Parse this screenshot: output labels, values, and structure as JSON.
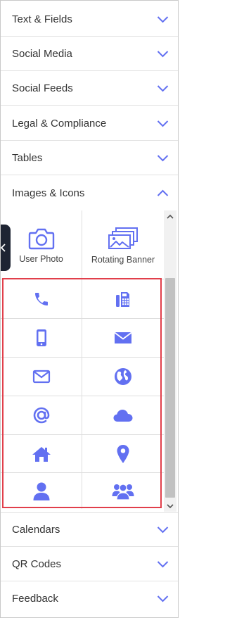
{
  "colors": {
    "accent": "#6270f1",
    "highlight": "#e13f4b",
    "divider": "#e2e2e2",
    "text": "#333333",
    "collapse_tab": "#1e2433"
  },
  "sections_top": [
    {
      "label": "Text & Fields",
      "state": "collapsed"
    },
    {
      "label": "Social Media",
      "state": "collapsed"
    },
    {
      "label": "Social Feeds",
      "state": "collapsed"
    },
    {
      "label": "Legal & Compliance",
      "state": "collapsed"
    },
    {
      "label": "Tables",
      "state": "collapsed"
    },
    {
      "label": "Images & Icons",
      "state": "expanded"
    }
  ],
  "images_icons": {
    "widgets": [
      {
        "label": "User Photo",
        "icon": "camera-icon"
      },
      {
        "label": "Rotating Banner",
        "icon": "image-stack-icon"
      }
    ],
    "icons": [
      "phone-icon",
      "fax-icon",
      "mobile-phone-icon",
      "envelope-solid-icon",
      "envelope-outline-icon",
      "globe-icon",
      "at-sign-icon",
      "cloud-icon",
      "home-icon",
      "map-marker-icon",
      "user-icon",
      "users-icon"
    ]
  },
  "sections_bottom": [
    {
      "label": "Calendars",
      "state": "collapsed"
    },
    {
      "label": "QR Codes",
      "state": "collapsed"
    },
    {
      "label": "Feedback",
      "state": "collapsed"
    }
  ]
}
